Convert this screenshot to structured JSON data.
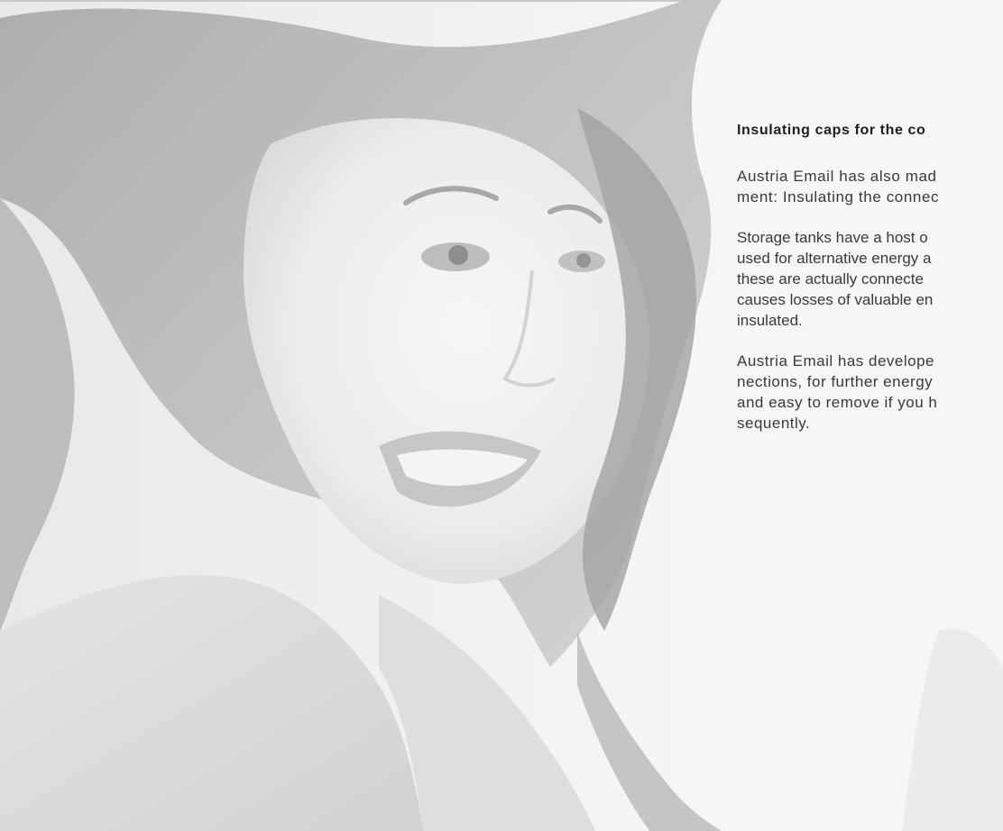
{
  "article": {
    "heading": "Insulating caps for the co",
    "paragraph_1": [
      "Austria Email has also mad",
      "ment: Insulating the connec"
    ],
    "paragraph_2": [
      "Storage tanks have a host o",
      "used for alternative energy a",
      "these are actually connecte",
      "causes losses of valuable en",
      "insulated."
    ],
    "paragraph_3": [
      "Austria Email has develope",
      "nections, for further energy",
      "and easy to remove if you h",
      "sequently."
    ]
  },
  "image": {
    "subject": "smiling-woman-photo"
  }
}
